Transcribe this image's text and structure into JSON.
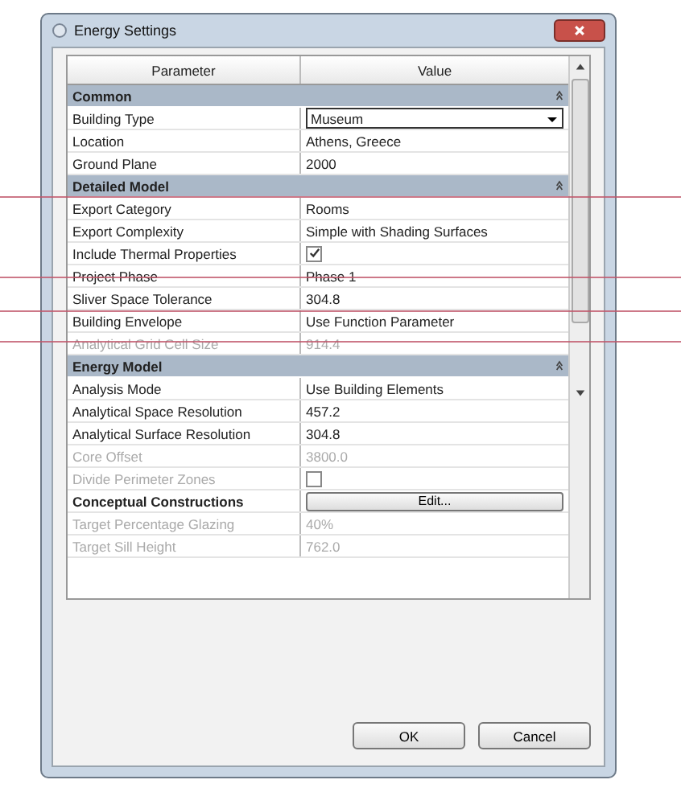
{
  "window": {
    "title": "Energy Settings"
  },
  "table": {
    "columns": [
      "Parameter",
      "Value"
    ],
    "rows": [
      {
        "kind": "section",
        "label": "Common"
      },
      {
        "kind": "dropdown",
        "label": "Building Type",
        "value": "Museum",
        "disabled": false
      },
      {
        "kind": "text",
        "label": "Location",
        "value": "Athens, Greece",
        "disabled": false
      },
      {
        "kind": "text",
        "label": "Ground Plane",
        "value": "2000",
        "disabled": false
      },
      {
        "kind": "section",
        "label": "Detailed Model"
      },
      {
        "kind": "text",
        "label": "Export Category",
        "value": "Rooms",
        "disabled": false
      },
      {
        "kind": "text",
        "label": "Export Complexity",
        "value": "Simple with Shading Surfaces",
        "disabled": false
      },
      {
        "kind": "checkbox",
        "label": "Include Thermal Properties",
        "checked": true,
        "disabled": false
      },
      {
        "kind": "text",
        "label": "Project Phase",
        "value": "Phase 1",
        "disabled": false
      },
      {
        "kind": "text",
        "label": "Sliver Space Tolerance",
        "value": "304.8",
        "disabled": false
      },
      {
        "kind": "text",
        "label": "Building Envelope",
        "value": "Use Function Parameter",
        "disabled": false
      },
      {
        "kind": "text",
        "label": "Analytical Grid Cell Size",
        "value": "914.4",
        "disabled": true
      },
      {
        "kind": "section",
        "label": "Energy Model"
      },
      {
        "kind": "text",
        "label": "Analysis Mode",
        "value": "Use Building Elements",
        "disabled": false
      },
      {
        "kind": "text",
        "label": "Analytical Space Resolution",
        "value": "457.2",
        "disabled": false
      },
      {
        "kind": "text",
        "label": "Analytical Surface Resolution",
        "value": "304.8",
        "disabled": false
      },
      {
        "kind": "text",
        "label": "Core Offset",
        "value": "3800.0",
        "disabled": true
      },
      {
        "kind": "checkbox",
        "label": "Divide Perimeter Zones",
        "checked": false,
        "disabled": true
      },
      {
        "kind": "button",
        "label": "Conceptual Constructions",
        "value": "Edit...",
        "disabled": false
      },
      {
        "kind": "text",
        "label": "Target Percentage Glazing",
        "value": "40%",
        "disabled": true
      },
      {
        "kind": "text",
        "label": "Target Sill Height",
        "value": "762.0",
        "disabled": true
      }
    ]
  },
  "buttons": [
    "OK",
    "Cancel"
  ]
}
